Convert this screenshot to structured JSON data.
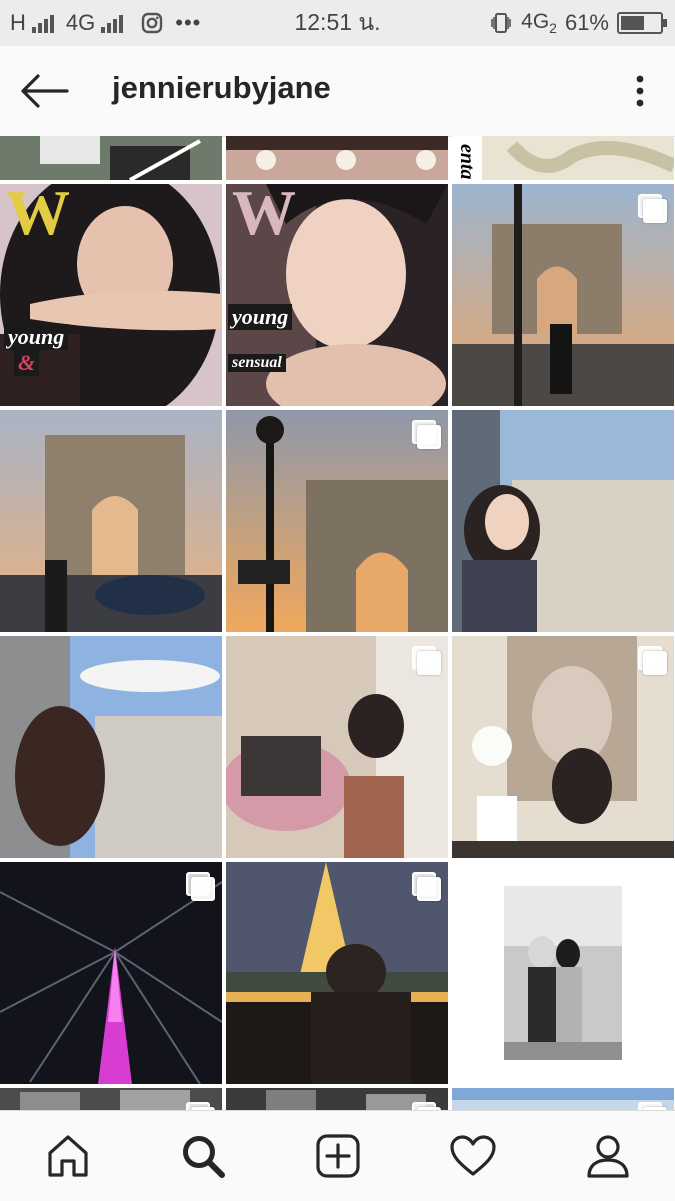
{
  "status_bar": {
    "network_left": "H",
    "network_mid": "4G",
    "time": "12:51 น.",
    "network_right": "4G",
    "network_right_sub": "2",
    "battery_text": "61%",
    "battery_level": 0.61
  },
  "header": {
    "username": "jennierubyjane",
    "back_icon": "arrow-left-icon",
    "more_icon": "more-vertical-icon"
  },
  "grid": {
    "tiles": [
      {
        "caption": "partial-top-1",
        "multi": false
      },
      {
        "caption": "partial-top-2",
        "multi": false
      },
      {
        "caption": "partial-top-3",
        "multi": false
      },
      {
        "caption": "magazine-cover-1",
        "multi": false
      },
      {
        "caption": "magazine-cover-2",
        "multi": false
      },
      {
        "caption": "arc-sunset-1",
        "multi": true
      },
      {
        "caption": "arc-street",
        "multi": false
      },
      {
        "caption": "lamp-arc",
        "multi": true
      },
      {
        "caption": "window-portrait",
        "multi": false
      },
      {
        "caption": "window-view",
        "multi": false
      },
      {
        "caption": "flowers-room",
        "multi": true
      },
      {
        "caption": "chanel-poster",
        "multi": true
      },
      {
        "caption": "eiffel-pink",
        "multi": true
      },
      {
        "caption": "eiffel-gold",
        "multi": true
      },
      {
        "caption": "bw-photo",
        "multi": false
      }
    ],
    "magazine_letter": "W",
    "magazine_word1": "young",
    "magazine_word2": "&",
    "magazine_word3": "sensual",
    "partial_text": "ental"
  },
  "bottom_nav": {
    "items": [
      {
        "name": "home",
        "icon": "home-icon"
      },
      {
        "name": "search",
        "icon": "search-icon",
        "active": true
      },
      {
        "name": "add",
        "icon": "plus-square-icon"
      },
      {
        "name": "activity",
        "icon": "heart-icon"
      },
      {
        "name": "profile",
        "icon": "person-icon"
      }
    ]
  }
}
